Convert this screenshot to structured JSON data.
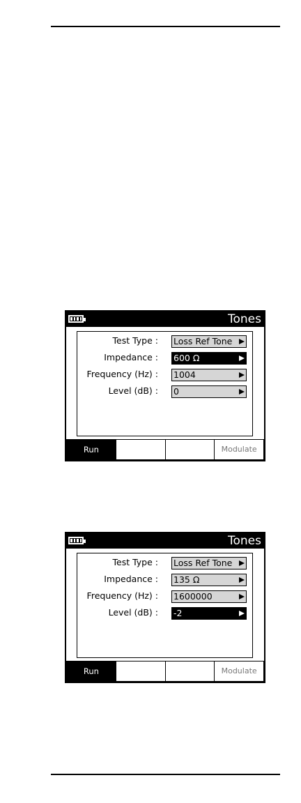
{
  "screens": [
    {
      "title": "Tones",
      "fields": [
        {
          "label": "Test Type :",
          "value": "Loss Ref Tone",
          "selected": false
        },
        {
          "label": "Impedance :",
          "value": "600 Ω",
          "selected": true
        },
        {
          "label": "Frequency (Hz) :",
          "value": "1004",
          "selected": false
        },
        {
          "label": "Level (dB) :",
          "value": "0",
          "selected": false
        }
      ],
      "softkeys": [
        "Run",
        "",
        "",
        "Modulate"
      ]
    },
    {
      "title": "Tones",
      "fields": [
        {
          "label": "Test Type :",
          "value": "Loss Ref Tone",
          "selected": false
        },
        {
          "label": "Impedance :",
          "value": "135 Ω",
          "selected": false
        },
        {
          "label": "Frequency (Hz) :",
          "value": "1600000",
          "selected": false
        },
        {
          "label": "Level (dB) :",
          "value": "-2",
          "selected": true
        }
      ],
      "softkeys": [
        "Run",
        "",
        "",
        "Modulate"
      ]
    }
  ],
  "icons": {
    "battery": "battery-full-icon",
    "arrow": "right-triangle-arrow-icon"
  }
}
